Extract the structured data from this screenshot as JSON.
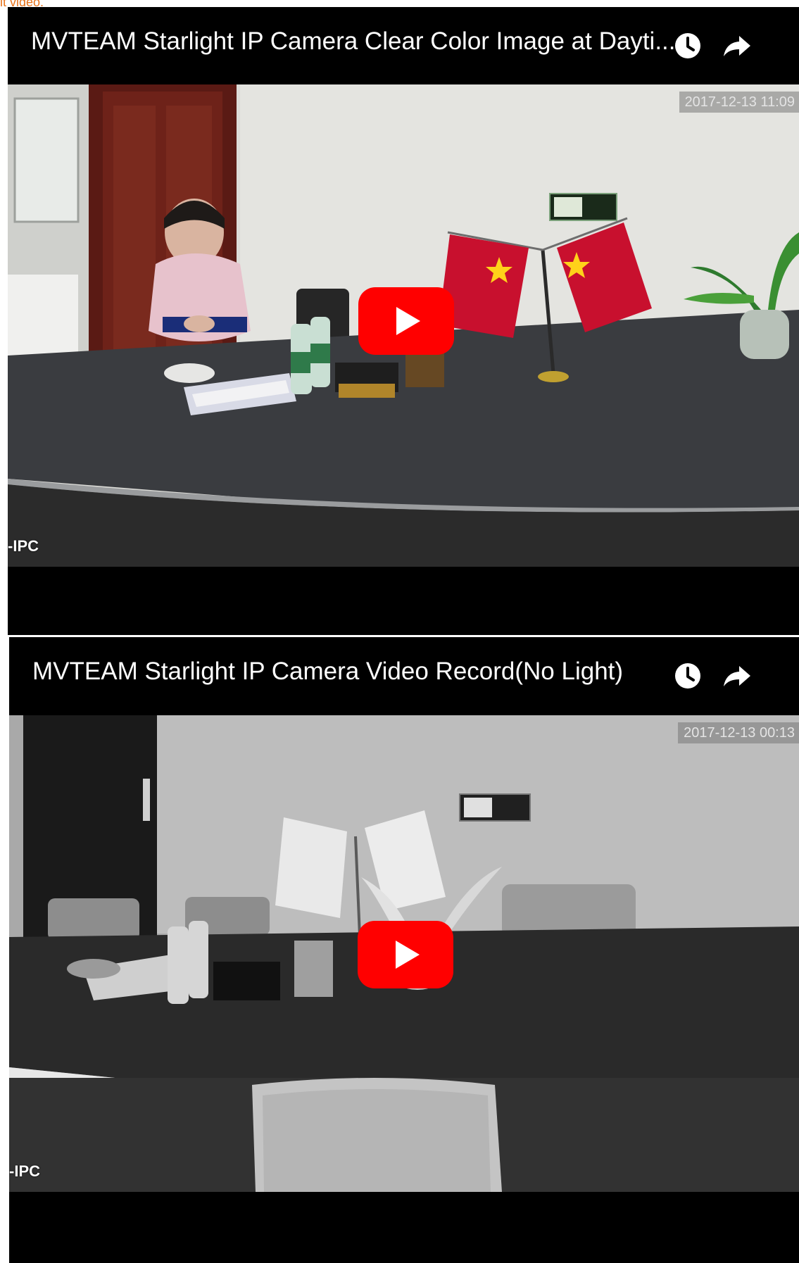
{
  "page": {
    "top_label": "it video."
  },
  "videos": [
    {
      "title": "MVTEAM Starlight IP Camera Clear Color Image at Dayti...",
      "timestamp": "2017-12-13 11:09",
      "overlay_label": "-IPC",
      "icons": [
        "clock-icon",
        "share-icon",
        "play-icon"
      ]
    },
    {
      "title": "MVTEAM Starlight IP Camera Video Record(No Light)",
      "timestamp": "2017-12-13 00:13",
      "overlay_label": "-IPC",
      "icons": [
        "clock-icon",
        "share-icon",
        "play-icon"
      ]
    }
  ],
  "colors": {
    "play_button_red": "#ff0000",
    "flag_red": "#c8102e",
    "label_orange": "#e8731a"
  }
}
